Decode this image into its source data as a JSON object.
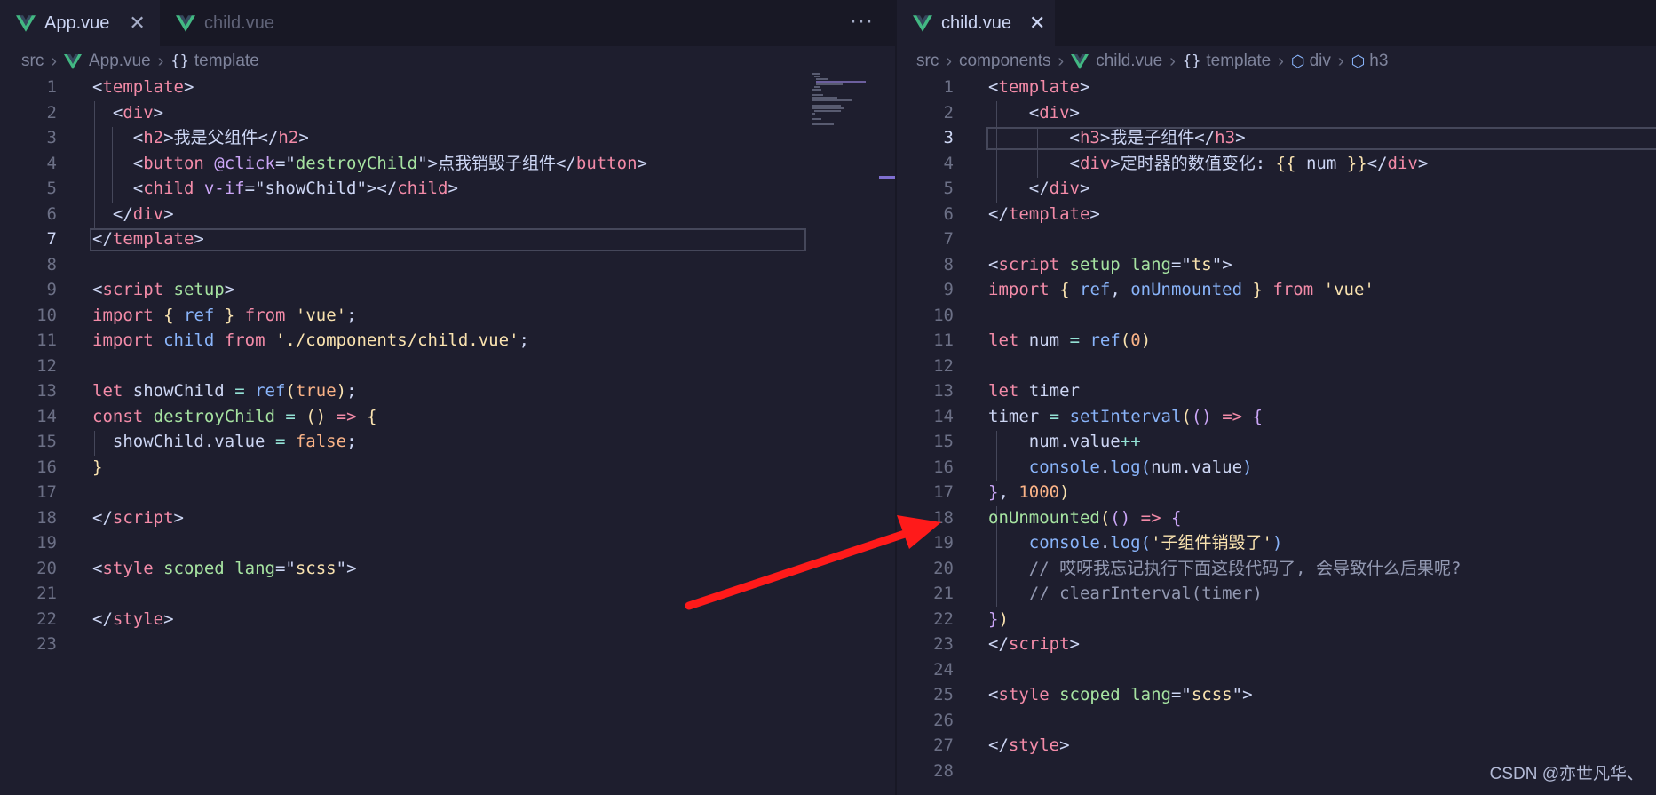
{
  "left_editor": {
    "tabs": [
      {
        "label": "App.vue",
        "active": true,
        "close": "✕"
      },
      {
        "label": "child.vue",
        "active": false
      }
    ],
    "more_actions": "···",
    "breadcrumb": {
      "src": "src",
      "file": "App.vue",
      "braces": "{}",
      "node": "template"
    },
    "lines": [
      {
        "n": "1",
        "tokens": [
          [
            "t-punc",
            "<"
          ],
          [
            "t-tag",
            "template"
          ],
          [
            "t-punc",
            ">"
          ]
        ]
      },
      {
        "n": "2",
        "tokens": [
          [
            "t-punc",
            "  <"
          ],
          [
            "t-tag",
            "div"
          ],
          [
            "t-punc",
            ">"
          ]
        ]
      },
      {
        "n": "3",
        "tokens": [
          [
            "t-punc",
            "    <"
          ],
          [
            "t-tag",
            "h2"
          ],
          [
            "t-punc",
            ">我是父组件</"
          ],
          [
            "t-tag",
            "h2"
          ],
          [
            "t-punc",
            ">"
          ]
        ]
      },
      {
        "n": "4",
        "tokens": [
          [
            "t-punc",
            "    <"
          ],
          [
            "t-tag",
            "button"
          ],
          [
            "t-punc",
            " "
          ],
          [
            "t-dir",
            "@click"
          ],
          [
            "t-punc",
            "=\""
          ],
          [
            "t-str",
            "destroyChild"
          ],
          [
            "t-punc",
            "\">点我销毁子组件</"
          ],
          [
            "t-tag",
            "button"
          ],
          [
            "t-punc",
            ">"
          ]
        ]
      },
      {
        "n": "5",
        "tokens": [
          [
            "t-punc",
            "    <"
          ],
          [
            "t-tag",
            "child"
          ],
          [
            "t-punc",
            " "
          ],
          [
            "t-dir",
            "v-if"
          ],
          [
            "t-punc",
            "=\""
          ],
          [
            "t-var",
            "showChild"
          ],
          [
            "t-punc",
            "\"></"
          ],
          [
            "t-tag",
            "child"
          ],
          [
            "t-punc",
            ">"
          ]
        ]
      },
      {
        "n": "6",
        "tokens": [
          [
            "t-punc",
            "  </"
          ],
          [
            "t-tag",
            "div"
          ],
          [
            "t-punc",
            ">"
          ]
        ]
      },
      {
        "n": "7",
        "tokens": [
          [
            "t-punc",
            "</"
          ],
          [
            "t-tag",
            "template"
          ],
          [
            "t-punc",
            ">"
          ]
        ]
      },
      {
        "n": "8",
        "tokens": []
      },
      {
        "n": "9",
        "tokens": [
          [
            "t-punc",
            "<"
          ],
          [
            "t-tag",
            "script"
          ],
          [
            "t-punc",
            " "
          ],
          [
            "t-attr",
            "setup"
          ],
          [
            "t-punc",
            ">"
          ]
        ]
      },
      {
        "n": "10",
        "tokens": [
          [
            "t-kw2",
            "import"
          ],
          [
            "t-punc",
            " "
          ],
          [
            "t-br1",
            "{"
          ],
          [
            "t-punc",
            " "
          ],
          [
            "t-fn",
            "ref"
          ],
          [
            "t-punc",
            " "
          ],
          [
            "t-br1",
            "}"
          ],
          [
            "t-punc",
            " "
          ],
          [
            "t-kw2",
            "from"
          ],
          [
            "t-punc",
            " "
          ],
          [
            "t-strq",
            "'vue'"
          ],
          [
            "t-punc",
            ";"
          ]
        ]
      },
      {
        "n": "11",
        "tokens": [
          [
            "t-kw2",
            "import"
          ],
          [
            "t-punc",
            " "
          ],
          [
            "t-fn",
            "child"
          ],
          [
            "t-punc",
            " "
          ],
          [
            "t-kw2",
            "from"
          ],
          [
            "t-punc",
            " "
          ],
          [
            "t-strq",
            "'./components/child.vue'"
          ],
          [
            "t-punc",
            ";"
          ]
        ]
      },
      {
        "n": "12",
        "tokens": []
      },
      {
        "n": "13",
        "tokens": [
          [
            "t-kw2",
            "let"
          ],
          [
            "t-punc",
            " "
          ],
          [
            "t-var",
            "showChild"
          ],
          [
            "t-punc",
            " "
          ],
          [
            "t-op",
            "="
          ],
          [
            "t-punc",
            " "
          ],
          [
            "t-fn",
            "ref"
          ],
          [
            "t-br1",
            "("
          ],
          [
            "t-bool",
            "true"
          ],
          [
            "t-br1",
            ")"
          ],
          [
            "t-punc",
            ";"
          ]
        ]
      },
      {
        "n": "14",
        "tokens": [
          [
            "t-kw2",
            "const"
          ],
          [
            "t-punc",
            " "
          ],
          [
            "t-attr",
            "destroyChild"
          ],
          [
            "t-punc",
            " "
          ],
          [
            "t-op",
            "="
          ],
          [
            "t-punc",
            " "
          ],
          [
            "t-br1",
            "()"
          ],
          [
            "t-punc",
            " "
          ],
          [
            "t-kw2",
            "=>"
          ],
          [
            "t-punc",
            " "
          ],
          [
            "t-br1",
            "{"
          ]
        ]
      },
      {
        "n": "15",
        "tokens": [
          [
            "t-punc",
            "  "
          ],
          [
            "t-var",
            "showChild"
          ],
          [
            "t-punc",
            "."
          ],
          [
            "t-var",
            "value"
          ],
          [
            "t-punc",
            " "
          ],
          [
            "t-op",
            "="
          ],
          [
            "t-punc",
            " "
          ],
          [
            "t-bool",
            "false"
          ],
          [
            "t-punc",
            ";"
          ]
        ]
      },
      {
        "n": "16",
        "tokens": [
          [
            "t-br1",
            "}"
          ]
        ]
      },
      {
        "n": "17",
        "tokens": []
      },
      {
        "n": "18",
        "tokens": [
          [
            "t-punc",
            "</"
          ],
          [
            "t-tag",
            "script"
          ],
          [
            "t-punc",
            ">"
          ]
        ]
      },
      {
        "n": "19",
        "tokens": []
      },
      {
        "n": "20",
        "tokens": [
          [
            "t-punc",
            "<"
          ],
          [
            "t-tag",
            "style"
          ],
          [
            "t-punc",
            " "
          ],
          [
            "t-attr",
            "scoped"
          ],
          [
            "t-punc",
            " "
          ],
          [
            "t-attr",
            "lang"
          ],
          [
            "t-punc",
            "=\""
          ],
          [
            "t-strq",
            "scss"
          ],
          [
            "t-punc",
            "\">"
          ]
        ]
      },
      {
        "n": "21",
        "tokens": []
      },
      {
        "n": "22",
        "tokens": [
          [
            "t-punc",
            "</"
          ],
          [
            "t-tag",
            "style"
          ],
          [
            "t-punc",
            ">"
          ]
        ]
      },
      {
        "n": "23",
        "tokens": []
      }
    ],
    "current_line": "7"
  },
  "right_editor": {
    "tabs": [
      {
        "label": "child.vue",
        "active": true,
        "close": "✕"
      }
    ],
    "breadcrumb": {
      "src": "src",
      "folder": "components",
      "file": "child.vue",
      "braces": "{}",
      "node": "template",
      "node2": "div",
      "node3": "h3"
    },
    "lines": [
      {
        "n": "1",
        "tokens": [
          [
            "t-punc",
            "<"
          ],
          [
            "t-tag",
            "template"
          ],
          [
            "t-punc",
            ">"
          ]
        ]
      },
      {
        "n": "2",
        "tokens": [
          [
            "t-punc",
            "    <"
          ],
          [
            "t-tag",
            "div"
          ],
          [
            "t-punc",
            ">"
          ]
        ]
      },
      {
        "n": "3",
        "tokens": [
          [
            "t-punc",
            "        <"
          ],
          [
            "t-tag",
            "h3"
          ],
          [
            "t-punc",
            ">我是子组件</"
          ],
          [
            "t-tag",
            "h3"
          ],
          [
            "t-punc",
            ">"
          ]
        ]
      },
      {
        "n": "4",
        "tokens": [
          [
            "t-punc",
            "        <"
          ],
          [
            "t-tag",
            "div"
          ],
          [
            "t-punc",
            ">定时器的数值变化: "
          ],
          [
            "t-br1",
            "{{"
          ],
          [
            "t-punc",
            " "
          ],
          [
            "t-var",
            "num"
          ],
          [
            "t-punc",
            " "
          ],
          [
            "t-br1",
            "}}"
          ],
          [
            "t-punc",
            "</"
          ],
          [
            "t-tag",
            "div"
          ],
          [
            "t-punc",
            ">"
          ]
        ]
      },
      {
        "n": "5",
        "tokens": [
          [
            "t-punc",
            "    </"
          ],
          [
            "t-tag",
            "div"
          ],
          [
            "t-punc",
            ">"
          ]
        ]
      },
      {
        "n": "6",
        "tokens": [
          [
            "t-punc",
            "</"
          ],
          [
            "t-tag",
            "template"
          ],
          [
            "t-punc",
            ">"
          ]
        ]
      },
      {
        "n": "7",
        "tokens": []
      },
      {
        "n": "8",
        "tokens": [
          [
            "t-punc",
            "<"
          ],
          [
            "t-tag",
            "script"
          ],
          [
            "t-punc",
            " "
          ],
          [
            "t-attr",
            "setup"
          ],
          [
            "t-punc",
            " "
          ],
          [
            "t-attr",
            "lang"
          ],
          [
            "t-punc",
            "=\""
          ],
          [
            "t-strq",
            "ts"
          ],
          [
            "t-punc",
            "\">"
          ]
        ]
      },
      {
        "n": "9",
        "tokens": [
          [
            "t-kw2",
            "import"
          ],
          [
            "t-punc",
            " "
          ],
          [
            "t-br1",
            "{"
          ],
          [
            "t-punc",
            " "
          ],
          [
            "t-fn",
            "ref"
          ],
          [
            "t-punc",
            ", "
          ],
          [
            "t-fn",
            "onUnmounted"
          ],
          [
            "t-punc",
            " "
          ],
          [
            "t-br1",
            "}"
          ],
          [
            "t-punc",
            " "
          ],
          [
            "t-kw2",
            "from"
          ],
          [
            "t-punc",
            " "
          ],
          [
            "t-strq",
            "'vue'"
          ]
        ]
      },
      {
        "n": "10",
        "tokens": []
      },
      {
        "n": "11",
        "tokens": [
          [
            "t-kw2",
            "let"
          ],
          [
            "t-punc",
            " "
          ],
          [
            "t-var",
            "num"
          ],
          [
            "t-punc",
            " "
          ],
          [
            "t-op",
            "="
          ],
          [
            "t-punc",
            " "
          ],
          [
            "t-fn",
            "ref"
          ],
          [
            "t-br1",
            "("
          ],
          [
            "t-num",
            "0"
          ],
          [
            "t-br1",
            ")"
          ]
        ]
      },
      {
        "n": "12",
        "tokens": []
      },
      {
        "n": "13",
        "tokens": [
          [
            "t-kw2",
            "let"
          ],
          [
            "t-punc",
            " "
          ],
          [
            "t-var",
            "timer"
          ]
        ]
      },
      {
        "n": "14",
        "tokens": [
          [
            "t-var",
            "timer"
          ],
          [
            "t-punc",
            " "
          ],
          [
            "t-op",
            "="
          ],
          [
            "t-punc",
            " "
          ],
          [
            "t-fn",
            "setInterval"
          ],
          [
            "t-br1",
            "("
          ],
          [
            "t-br2",
            "()"
          ],
          [
            "t-punc",
            " "
          ],
          [
            "t-kw2",
            "=>"
          ],
          [
            "t-punc",
            " "
          ],
          [
            "t-br2",
            "{"
          ]
        ]
      },
      {
        "n": "15",
        "tokens": [
          [
            "t-punc",
            "    "
          ],
          [
            "t-var",
            "num"
          ],
          [
            "t-punc",
            "."
          ],
          [
            "t-var",
            "value"
          ],
          [
            "t-op",
            "++"
          ]
        ]
      },
      {
        "n": "16",
        "tokens": [
          [
            "t-punc",
            "    "
          ],
          [
            "t-fn",
            "console"
          ],
          [
            "t-punc",
            "."
          ],
          [
            "t-fn",
            "log"
          ],
          [
            "t-br3",
            "("
          ],
          [
            "t-var",
            "num"
          ],
          [
            "t-punc",
            "."
          ],
          [
            "t-var",
            "value"
          ],
          [
            "t-br3",
            ")"
          ]
        ]
      },
      {
        "n": "17",
        "tokens": [
          [
            "t-br2",
            "}"
          ],
          [
            "t-punc",
            ", "
          ],
          [
            "t-num",
            "1000"
          ],
          [
            "t-br1",
            ")"
          ]
        ]
      },
      {
        "n": "18",
        "tokens": [
          [
            "t-attr",
            "onUnmounted"
          ],
          [
            "t-br1",
            "("
          ],
          [
            "t-br2",
            "()"
          ],
          [
            "t-punc",
            " "
          ],
          [
            "t-kw2",
            "=>"
          ],
          [
            "t-punc",
            " "
          ],
          [
            "t-br2",
            "{"
          ]
        ]
      },
      {
        "n": "19",
        "tokens": [
          [
            "t-punc",
            "    "
          ],
          [
            "t-fn",
            "console"
          ],
          [
            "t-punc",
            "."
          ],
          [
            "t-fn",
            "log"
          ],
          [
            "t-br3",
            "("
          ],
          [
            "t-strq",
            "'子组件销毁了'"
          ],
          [
            "t-br3",
            ")"
          ]
        ]
      },
      {
        "n": "20",
        "tokens": [
          [
            "t-cm",
            "    // 哎呀我忘记执行下面这段代码了, 会导致什么后果呢?"
          ]
        ]
      },
      {
        "n": "21",
        "tokens": [
          [
            "t-cm",
            "    // clearInterval(timer)"
          ]
        ]
      },
      {
        "n": "22",
        "tokens": [
          [
            "t-br2",
            "}"
          ],
          [
            "t-br1",
            ")"
          ]
        ]
      },
      {
        "n": "23",
        "tokens": [
          [
            "t-punc",
            "</"
          ],
          [
            "t-tag",
            "script"
          ],
          [
            "t-punc",
            ">"
          ]
        ]
      },
      {
        "n": "24",
        "tokens": []
      },
      {
        "n": "25",
        "tokens": [
          [
            "t-punc",
            "<"
          ],
          [
            "t-tag",
            "style"
          ],
          [
            "t-punc",
            " "
          ],
          [
            "t-attr",
            "scoped"
          ],
          [
            "t-punc",
            " "
          ],
          [
            "t-attr",
            "lang"
          ],
          [
            "t-punc",
            "=\""
          ],
          [
            "t-strq",
            "scss"
          ],
          [
            "t-punc",
            "\">"
          ]
        ]
      },
      {
        "n": "26",
        "tokens": []
      },
      {
        "n": "27",
        "tokens": [
          [
            "t-punc",
            "</"
          ],
          [
            "t-tag",
            "style"
          ],
          [
            "t-punc",
            ">"
          ]
        ]
      },
      {
        "n": "28",
        "tokens": []
      }
    ],
    "current_line": "3"
  },
  "colors": {
    "background": "#1e1e2e",
    "arrow": "#ff1a1a",
    "vue_green": "#42b883"
  },
  "watermark": "CSDN @亦世凡华、"
}
